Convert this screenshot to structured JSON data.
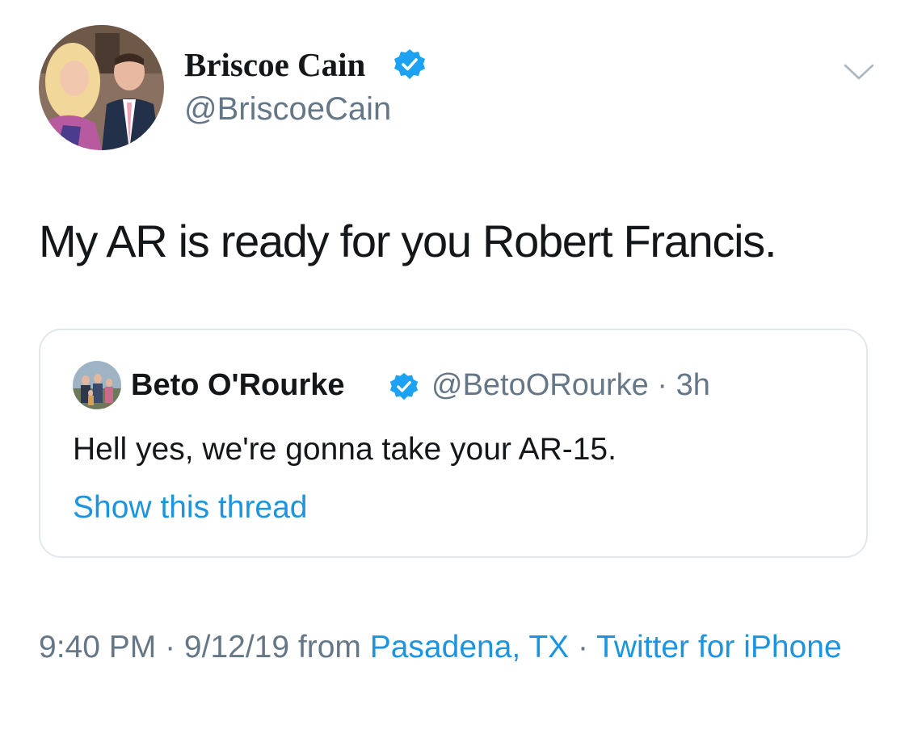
{
  "tweet": {
    "author": {
      "display_name": "Briscoe Cain",
      "handle": "@BriscoeCain",
      "verified": true
    },
    "text": "My AR is ready for you Robert Francis.",
    "menu_icon": "chevron-down-icon",
    "quoted": {
      "author_name": "Beto O'Rourke",
      "verified": true,
      "handle": "@BetoORourke",
      "separator": "·",
      "time_ago": "3h",
      "text": "Hell yes, we're gonna take your AR-15.",
      "show_thread": "Show this thread"
    },
    "meta": {
      "time": "9:40 PM",
      "separator": " · ",
      "date": "9/12/19",
      "from_word": "from",
      "location": "Pasadena, TX",
      "source": "Twitter for iPhone"
    }
  },
  "colors": {
    "text": "#14171a",
    "secondary": "#657786",
    "link": "#1b95e0",
    "verified": "#1da1f2",
    "border": "#e1e8ed"
  }
}
